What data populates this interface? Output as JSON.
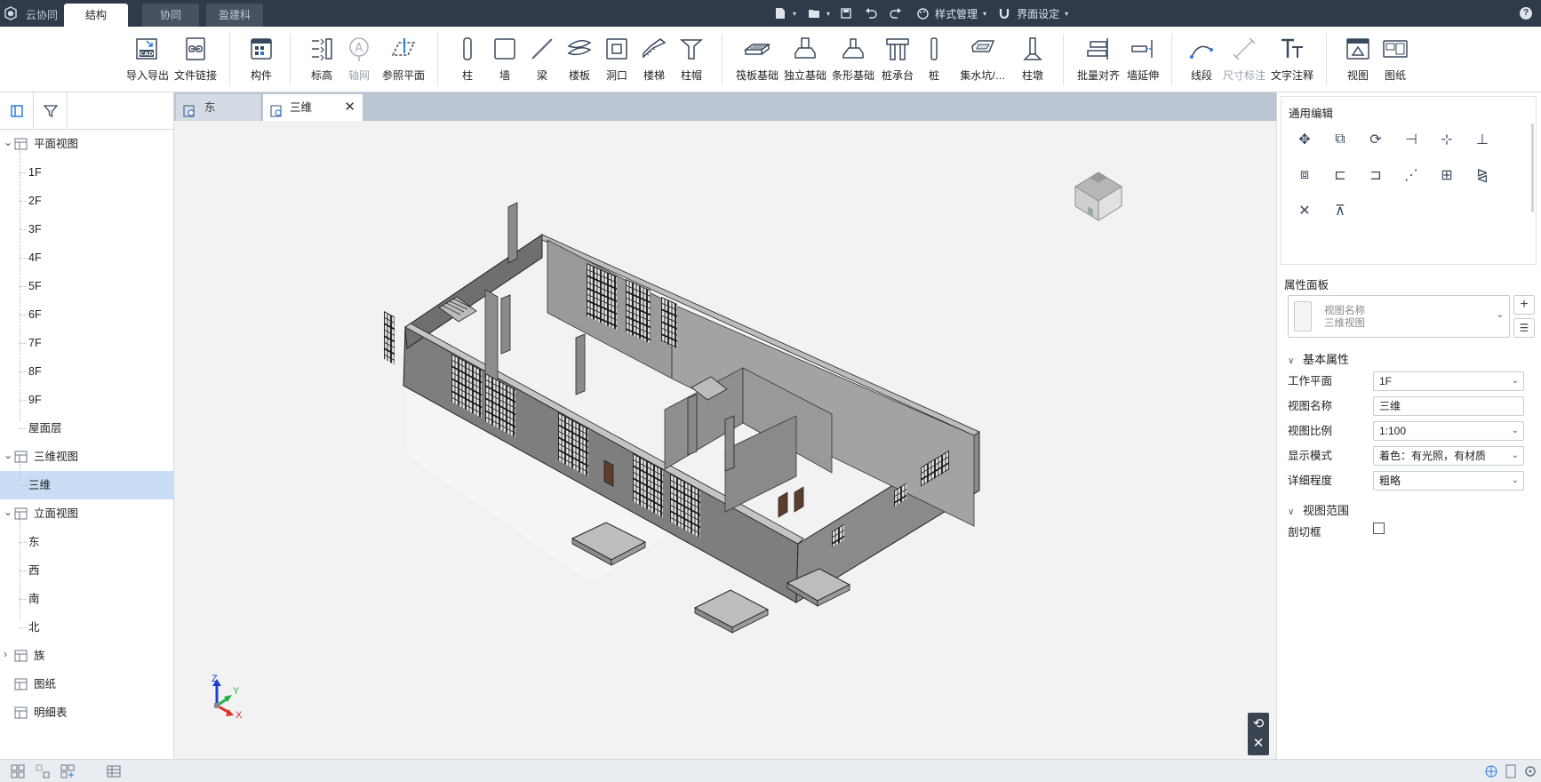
{
  "titlebar": {
    "tabs": [
      {
        "label": "云协同",
        "state": "inactive"
      },
      {
        "label": "结构",
        "state": "active"
      },
      {
        "label": "协同",
        "state": "inactive"
      },
      {
        "label": "盈建科",
        "state": "inactive"
      }
    ],
    "style_manage_label": "样式管理",
    "ui_settings_label": "界面设定",
    "help_label": "?"
  },
  "ribbon": {
    "groups": [
      {
        "items": [
          {
            "label": "导入导出",
            "icon": "cad-import-icon"
          },
          {
            "label": "文件链接",
            "icon": "file-link-icon"
          }
        ]
      },
      {
        "items": [
          {
            "label": "构件",
            "icon": "component-icon"
          }
        ]
      },
      {
        "items": [
          {
            "label": "标高",
            "icon": "level-icon"
          },
          {
            "label": "轴网",
            "icon": "grid-axis-icon",
            "disabled": true
          },
          {
            "label": "参照平面",
            "icon": "reference-plane-icon"
          }
        ]
      },
      {
        "items": [
          {
            "label": "柱",
            "icon": "column-icon"
          },
          {
            "label": "墙",
            "icon": "wall-icon"
          },
          {
            "label": "梁",
            "icon": "beam-icon"
          },
          {
            "label": "楼板",
            "icon": "floor-slab-icon"
          },
          {
            "label": "洞口",
            "icon": "opening-icon"
          },
          {
            "label": "楼梯",
            "icon": "stair-icon"
          },
          {
            "label": "柱帽",
            "icon": "column-cap-icon"
          }
        ]
      },
      {
        "items": [
          {
            "label": "筏板基础",
            "icon": "raft-foundation-icon"
          },
          {
            "label": "独立基础",
            "icon": "isolated-foundation-icon"
          },
          {
            "label": "条形基础",
            "icon": "strip-foundation-icon"
          },
          {
            "label": "桩承台",
            "icon": "pile-cap-icon"
          },
          {
            "label": "桩",
            "icon": "pile-icon"
          },
          {
            "label": "集水坑/…",
            "icon": "sump-pit-icon"
          },
          {
            "label": "柱墩",
            "icon": "column-pier-icon"
          }
        ]
      },
      {
        "items": [
          {
            "label": "批量对齐",
            "icon": "batch-align-icon"
          },
          {
            "label": "墙延伸",
            "icon": "wall-extend-icon"
          }
        ]
      },
      {
        "items": [
          {
            "label": "线段",
            "icon": "line-segment-icon"
          },
          {
            "label": "尺寸标注",
            "icon": "dimension-icon",
            "disabled": true
          },
          {
            "label": "文字注释",
            "icon": "text-annotation-icon"
          }
        ]
      },
      {
        "items": [
          {
            "label": "视图",
            "icon": "view-icon"
          },
          {
            "label": "图纸",
            "icon": "drawing-sheet-icon"
          }
        ]
      }
    ]
  },
  "tree": {
    "nodes": [
      {
        "label": "平面视图",
        "level": 0,
        "expanded": true
      },
      {
        "label": "1F",
        "level": 1
      },
      {
        "label": "2F",
        "level": 1
      },
      {
        "label": "3F",
        "level": 1
      },
      {
        "label": "4F",
        "level": 1
      },
      {
        "label": "5F",
        "level": 1
      },
      {
        "label": "6F",
        "level": 1
      },
      {
        "label": "7F",
        "level": 1
      },
      {
        "label": "8F",
        "level": 1
      },
      {
        "label": "9F",
        "level": 1
      },
      {
        "label": "屋面层",
        "level": 1
      },
      {
        "label": "三维视图",
        "level": 0,
        "expanded": true
      },
      {
        "label": "三维",
        "level": 1,
        "selected": true
      },
      {
        "label": "立面视图",
        "level": 0,
        "expanded": true
      },
      {
        "label": "东",
        "level": 1
      },
      {
        "label": "西",
        "level": 1
      },
      {
        "label": "南",
        "level": 1
      },
      {
        "label": "北",
        "level": 1
      },
      {
        "label": "族",
        "level": 0,
        "expanded": false
      },
      {
        "label": "图纸",
        "level": 0
      },
      {
        "label": "明细表",
        "level": 0
      }
    ]
  },
  "view_tabs": [
    {
      "label": "东",
      "active": false
    },
    {
      "label": "三维",
      "active": true
    }
  ],
  "axes": {
    "z": "Z",
    "y": "Y",
    "x": "X"
  },
  "general_edit": {
    "title": "通用编辑",
    "tools": [
      "move-icon",
      "copy-icon",
      "rotate-icon",
      "align-icon",
      "split-icon",
      "break-icon",
      "offset-icon",
      "trim-extend-icon",
      "trim-single-icon",
      "array-linear-icon",
      "array-rect-icon",
      "mirror-icon",
      "delete-icon",
      "pin-icon"
    ]
  },
  "properties": {
    "title": "属性面板",
    "type_selector": {
      "line1": "视图名称",
      "line2": "三维视图"
    },
    "basic_section": "基本属性",
    "rows": [
      {
        "label": "工作平面",
        "value": "1F",
        "kind": "select"
      },
      {
        "label": "视图名称",
        "value": "三维",
        "kind": "input"
      },
      {
        "label": "视图比例",
        "value": "1:100",
        "kind": "select"
      },
      {
        "label": "显示模式",
        "value": "着色：有光照，有材质",
        "kind": "select"
      },
      {
        "label": "详细程度",
        "value": "粗略",
        "kind": "select"
      }
    ],
    "range_section": "视图范围",
    "section_box_label": "剖切框"
  }
}
